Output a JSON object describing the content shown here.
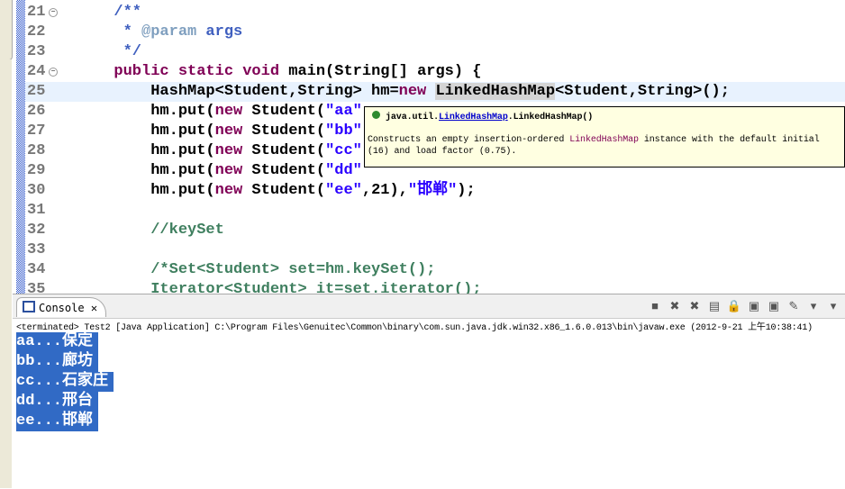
{
  "editor": {
    "lines": [
      {
        "n": "21",
        "fold": true,
        "html": "  <span class='cm'>/**</span>"
      },
      {
        "n": "22",
        "html": "   <span class='cm'>* </span><span class='tag'>@param</span><span class='cm'> args</span>"
      },
      {
        "n": "23",
        "html": "   <span class='cm'>*/</span>"
      },
      {
        "n": "24",
        "fold": true,
        "html": "  <span class='kw'>public static void</span> main(String[] args) {"
      },
      {
        "n": "25",
        "cur": true,
        "html": "      HashMap&lt;Student,String&gt; hm=<span class='kw'>new</span> <span class='hl'>LinkedHashMap</span>&lt;Student,String&gt;();"
      },
      {
        "n": "26",
        "html": "      hm.put(<span class='kw'>new</span> Student(<span class='str'>\"aa\"</span>"
      },
      {
        "n": "27",
        "html": "      hm.put(<span class='kw'>new</span> Student(<span class='str'>\"bb\"</span>"
      },
      {
        "n": "28",
        "html": "      hm.put(<span class='kw'>new</span> Student(<span class='str'>\"cc\"</span>"
      },
      {
        "n": "29",
        "html": "      hm.put(<span class='kw'>new</span> Student(<span class='str'>\"dd\"</span>"
      },
      {
        "n": "30",
        "html": "      hm.put(<span class='kw'>new</span> Student(<span class='str'>\"ee\"</span>,21),<span class='str'>\"邯郸\"</span>);"
      },
      {
        "n": "31",
        "html": ""
      },
      {
        "n": "32",
        "html": "      <span class='lc'>//keySet</span>"
      },
      {
        "n": "33",
        "html": ""
      },
      {
        "n": "34",
        "html": "      <span class='lc'>/*Set&lt;Student&gt; set=hm.keySet();</span>"
      },
      {
        "n": "35",
        "html": "      <span class='lc'>Iterator&lt;Student&gt; it=set.iterator();</span>"
      }
    ]
  },
  "tooltip": {
    "prefix": "java.util.",
    "link": "LinkedHashMap",
    "suffix": ".LinkedHashMap()",
    "desc1": "Constructs an empty insertion-ordered ",
    "desc_code": "LinkedHashMap",
    "desc2": " instance with the default initial",
    "desc3": "(16) and load factor (0.75)."
  },
  "console": {
    "tab": "Console",
    "status": "<terminated> Test2 [Java Application] C:\\Program Files\\Genuitec\\Common\\binary\\com.sun.java.jdk.win32.x86_1.6.0.013\\bin\\javaw.exe (2012-9-21 上午10:38:41)",
    "output": [
      "aa...保定",
      "bb...廊坊",
      "cc...石家庄",
      "dd...邢台",
      "ee...邯郸"
    ]
  }
}
